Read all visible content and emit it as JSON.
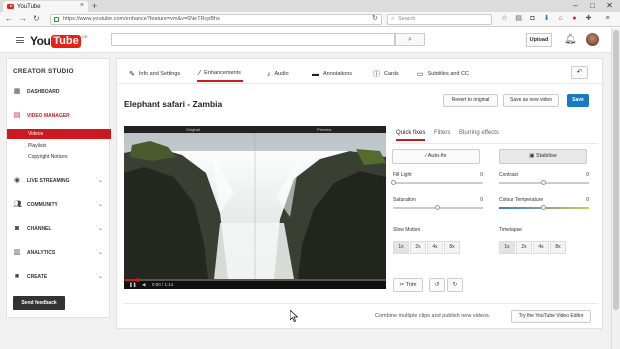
{
  "browser": {
    "tab_title": "YouTube",
    "url": "https://www.youtube.com/enhance?feature=vm&v=6NeTRcpBhs",
    "search_placeholder": "Search"
  },
  "header": {
    "logo_you": "You",
    "logo_tube": "Tube",
    "logo_region": "GB",
    "upload_label": "Upload"
  },
  "sidebar": {
    "title": "CREATOR STUDIO",
    "sections": [
      {
        "label": "DASHBOARD",
        "icon": "dashboard-icon"
      },
      {
        "label": "VIDEO MANAGER",
        "icon": "video-manager-icon"
      },
      {
        "label": "LIVE STREAMING",
        "icon": "live-streaming-icon"
      },
      {
        "label": "COMMUNITY",
        "icon": "community-icon"
      },
      {
        "label": "CHANNEL",
        "icon": "channel-icon"
      },
      {
        "label": "ANALYTICS",
        "icon": "analytics-icon"
      },
      {
        "label": "CREATE",
        "icon": "create-icon"
      }
    ],
    "video_manager_items": [
      "Videos",
      "Playlists",
      "Copyright Notices"
    ],
    "feedback_label": "Send feedback"
  },
  "editor": {
    "tabs": [
      {
        "label": "Info and Settings",
        "icon": "pencil-icon"
      },
      {
        "label": "Enhancements",
        "icon": "magic-wand-icon"
      },
      {
        "label": "Audio",
        "icon": "music-note-icon"
      },
      {
        "label": "Annotations",
        "icon": "speech-bubble-icon"
      },
      {
        "label": "Cards",
        "icon": "info-icon"
      },
      {
        "label": "Subtitles and CC",
        "icon": "subtitles-icon"
      }
    ],
    "active_tab": "Enhancements",
    "video_title": "Elephant safari - Zambia",
    "revert_label": "Revert to original",
    "save_new_label": "Save as new video",
    "save_label": "Save",
    "player": {
      "left_label": "Original",
      "right_label": "Preview",
      "time": "0:00 / 1:14"
    },
    "right_tabs": [
      "Quick fixes",
      "Filters",
      "Blurring effects"
    ],
    "autofix_label": "Auto-fix",
    "stabilise_label": "Stabilise",
    "sliders": [
      {
        "label": "Fill Light",
        "value": "0"
      },
      {
        "label": "Contrast",
        "value": "0"
      },
      {
        "label": "Saturation",
        "value": "0"
      },
      {
        "label": "Colour Temperature",
        "value": "0"
      }
    ],
    "slow_motion_label": "Slow Motion",
    "timelapse_label": "Timelapse",
    "speed_options": [
      "1x",
      "2x",
      "4x",
      "8x"
    ],
    "trim_label": "Trim",
    "combine_text": "Combine multiple clips and publish new videos.",
    "try_editor_label": "Try the YouTube Video Editor"
  },
  "colors": {
    "accent_red": "#cc181e",
    "save_blue": "#167ac6"
  }
}
